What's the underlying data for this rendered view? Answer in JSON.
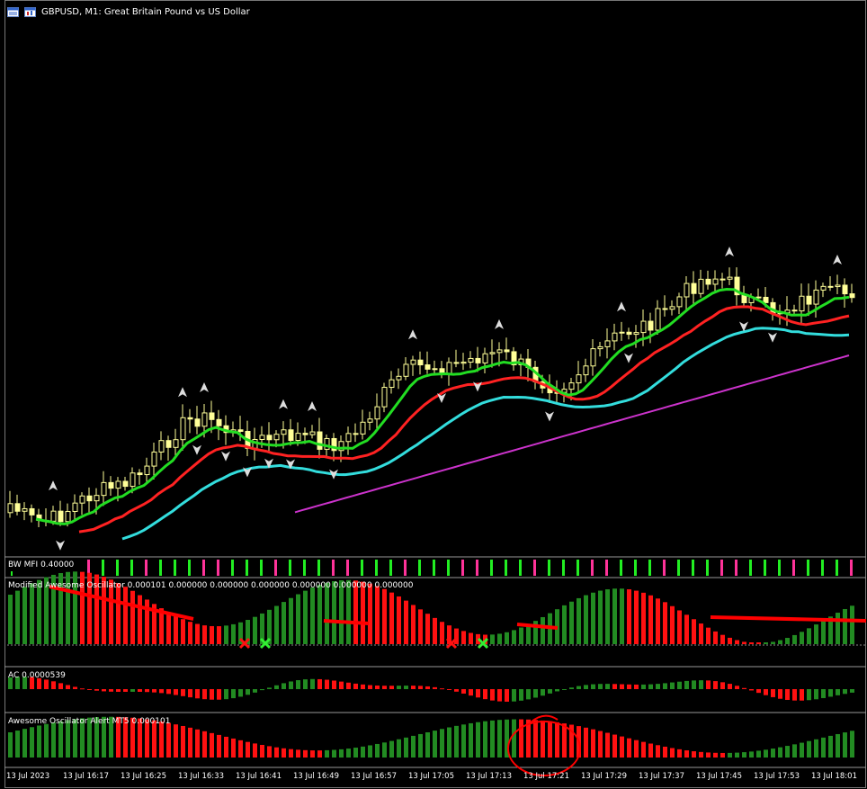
{
  "window": {
    "title": "GBPUSD, M1:  Great Britain Pound vs US Dollar",
    "icons": [
      "window-menu-icon",
      "chart-type-icon"
    ]
  },
  "panes": {
    "mfi": {
      "label": "BW MFI 0.40000"
    },
    "mao": {
      "label": "Modified Awesome Oscillator 0.000101 0.000000 0.000000 0.000000 0.000000 0.000000 0.000000"
    },
    "ac": {
      "label": "AC 0.0000539"
    },
    "aoa": {
      "label": "Awesome Oscillator Alert MT5 0.000101"
    }
  },
  "time_axis": [
    "13 Jul 2023",
    "13 Jul 16:17",
    "13 Jul 16:25",
    "13 Jul 16:33",
    "13 Jul 16:41",
    "13 Jul 16:49",
    "13 Jul 16:57",
    "13 Jul 17:05",
    "13 Jul 17:13",
    "13 Jul 17:21",
    "13 Jul 17:29",
    "13 Jul 17:37",
    "13 Jul 17:45",
    "13 Jul 17:53",
    "13 Jul 18:01"
  ],
  "colors": {
    "background": "#000000",
    "candle": "#ffff99",
    "alligator_jaw": "#33dddd",
    "alligator_teeth": "#ff2222",
    "alligator_lips": "#22dd22",
    "slow_ma": "#cc33cc",
    "osc_up": "#228b22",
    "osc_down": "#ff1111",
    "mfi_green": "#22ee22",
    "mfi_pink": "#ff3399",
    "fractal": "#dddddd",
    "annotation": "#ff0000"
  },
  "chart_data": {
    "type": "candlestick",
    "symbol": "GBPUSD",
    "timeframe": "M1",
    "bars": 118,
    "indicators": [
      "Alligator",
      "BW MFI",
      "Modified Awesome Oscillator",
      "AC",
      "Awesome Oscillator Alert MT5"
    ],
    "mfi_value": 0.4,
    "ao_value": 0.000101,
    "ac_value": 5.39e-05
  }
}
